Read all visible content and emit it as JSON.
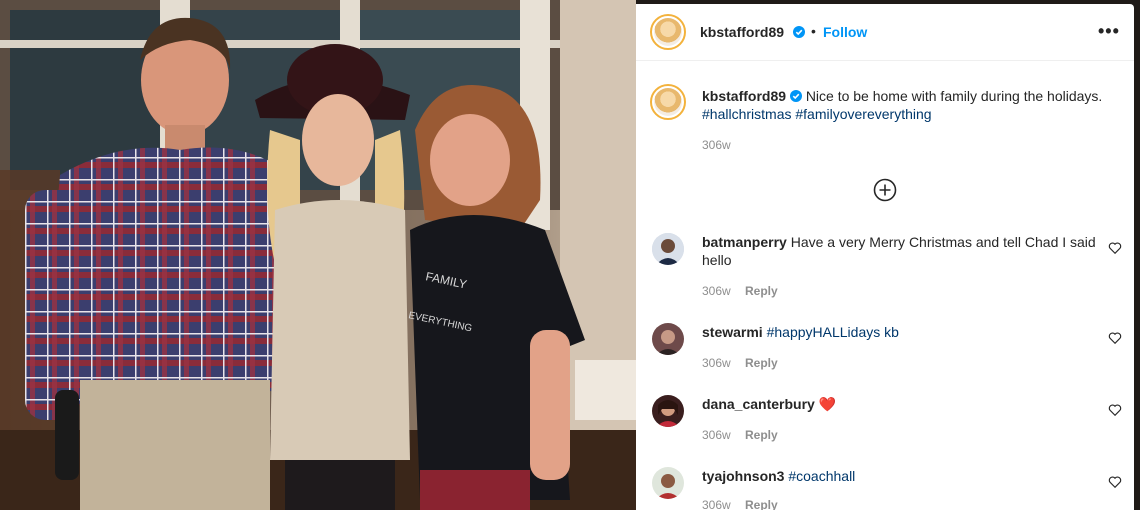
{
  "post": {
    "username": "kbstafford89",
    "follow_label": "Follow",
    "dot": "•",
    "more_icon": "•••",
    "caption_username": "kbstafford89",
    "caption_text": "Nice to be home with family during the holidays.",
    "caption_tags": [
      "#hallchristmas",
      "#familyovereverything"
    ],
    "time": "306w",
    "photo_shirt_text_1": "FAMILY",
    "photo_shirt_text_2": "EVERYTHING"
  },
  "comments": [
    {
      "user": "batmanperry",
      "text": "Have a very Merry Christmas and tell Chad I said hello",
      "time": "306w",
      "reply": "Reply"
    },
    {
      "user": "stewarmi",
      "text": "#happyHALLidays kb",
      "time": "306w",
      "reply": "Reply"
    },
    {
      "user": "dana_canterbury",
      "text": "❤️",
      "time": "306w",
      "reply": "Reply"
    },
    {
      "user": "tyajohnson3",
      "text": "#coachhall",
      "time": "306w",
      "reply": "Reply"
    }
  ],
  "colors": {
    "link": "#0095f6",
    "hashtag": "#00376b",
    "muted": "#8e8e8e",
    "text": "#262626"
  }
}
